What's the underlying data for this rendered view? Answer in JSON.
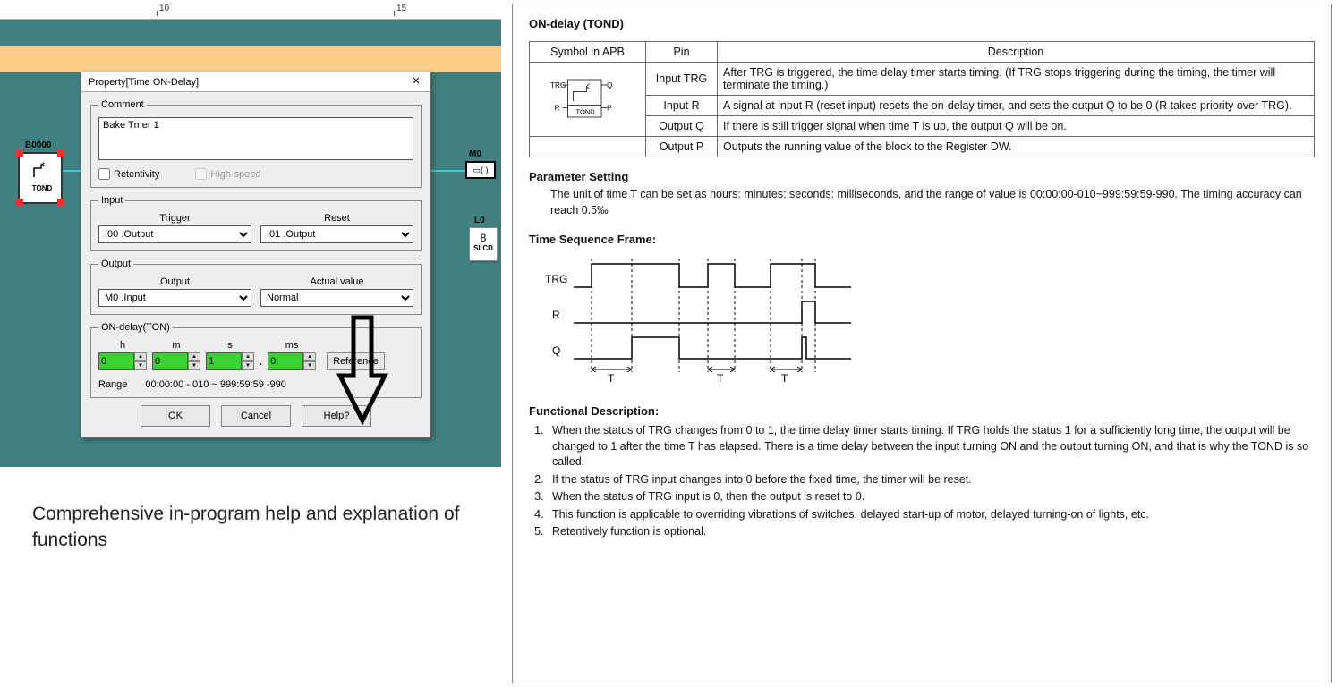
{
  "ruler": {
    "t10": "10",
    "t15": "15"
  },
  "canvas": {
    "tond_block_id": "B0000",
    "tond_caption": "TOND",
    "m0_label": "M0",
    "m0_inner": "▭( )",
    "l0_label": "L0",
    "l0_num": "8",
    "l0_cap": "SLCD"
  },
  "dialog": {
    "title": "Property[Time ON-Delay]",
    "comment_legend": "Comment",
    "comment_value": "Bake Tmer 1",
    "retentivity": "Retentivity",
    "highspeed": "High-speed",
    "input_legend": "Input",
    "trigger_label": "Trigger",
    "reset_label": "Reset",
    "trigger_value": "I00 .Output",
    "reset_value": "I01 .Output",
    "output_legend": "Output",
    "output_label": "Output",
    "actual_label": "Actual value",
    "output_value": "M0 .Input",
    "actual_value": "Normal",
    "ton_legend": "ON-delay(TON)",
    "h": "h",
    "m": "m",
    "s": "s",
    "ms": "ms",
    "hv": "0",
    "mv": "0",
    "sv": "1",
    "msv": "0",
    "reference": "Reference",
    "range_label": "Range",
    "range_value": "00:00:00 - 010 ~ 999:59:59 -990",
    "ok": "OK",
    "cancel": "Cancel",
    "help": "Help?"
  },
  "caption": "Comprehensive in-program help and explanation of functions",
  "help": {
    "title": "ON-delay  (TOND)",
    "th_sym": "Symbol in APB",
    "th_pin": "Pin",
    "th_desc": "Description",
    "sym_trg": "TRG",
    "sym_r": "R",
    "sym_q": "Q",
    "sym_p": "P",
    "sym_tond": "TOND",
    "pin_trg": "Input TRG",
    "pin_r": "Input R",
    "pin_q": "Output Q",
    "pin_p": "Output P",
    "desc_trg": "After TRG is triggered, the time delay timer starts timing. (If TRG stops triggering during the timing, the timer will terminate the timing.)",
    "desc_r": "A signal at input R (reset input) resets the on-delay timer, and sets the output Q to be 0 (R takes priority over TRG).",
    "desc_q": "If there is still trigger signal when time T is up, the output Q will be on.",
    "desc_p": "Outputs the running value of the block to the Register DW.",
    "param_head": "Parameter Setting",
    "param_body": "The unit of time T can be set as hours: minutes: seconds: milliseconds, and the range of value is 00:00:00-010~999:59:59-990. The timing accuracy can reach 0.5‰",
    "tsf_head": "Time Sequence Frame:",
    "tsf_trg": "TRG",
    "tsf_r": "R",
    "tsf_q": "Q",
    "tsf_t": "T",
    "fd_head": "Functional Description:",
    "fd1": "When the status of TRG changes from 0 to 1, the time delay timer starts timing. If TRG holds the status 1 for a sufficiently long time, the output will be changed to 1 after the time T has elapsed. There is a time delay between the input turning ON and the output turning ON, and that is why the TOND is so called.",
    "fd2": "If the status of TRG input changes into 0 before the fixed time, the timer will be reset.",
    "fd3": "When the status of TRG input is 0, then the output is reset to 0.",
    "fd4": "This function is applicable to overriding vibrations of switches, delayed start-up of motor, delayed turning-on of lights, etc.",
    "fd5": "Retentively function is optional."
  }
}
